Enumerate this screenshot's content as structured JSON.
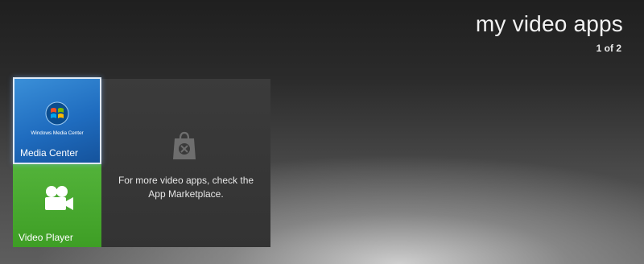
{
  "header": {
    "title": "my video apps",
    "page_counter": "1 of 2"
  },
  "tiles": [
    {
      "id": "media-center",
      "label": "Media Center",
      "logo_text": "Windows Media Center",
      "icon": "windows-logo-icon",
      "color": "#1f6cbf",
      "selected": true
    },
    {
      "id": "video-player",
      "label": "Video Player",
      "icon": "video-camera-icon",
      "color": "#3e9e25",
      "selected": false
    },
    {
      "id": "marketplace",
      "message": "For more video apps, check the App Marketplace.",
      "icon": "shopping-bag-icon",
      "color": "#363636",
      "selected": false
    }
  ]
}
